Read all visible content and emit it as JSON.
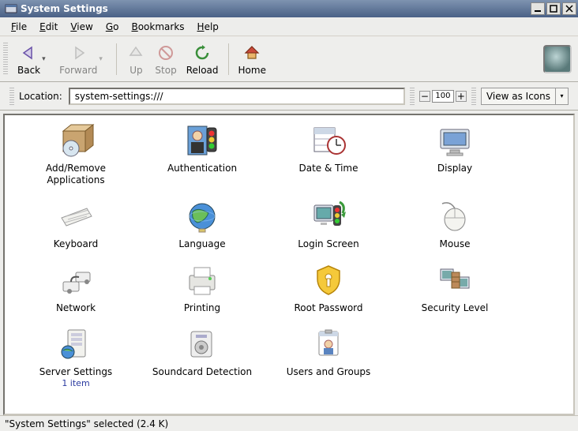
{
  "window": {
    "title": "System Settings"
  },
  "menu": {
    "file": "File",
    "edit": "Edit",
    "view": "View",
    "go": "Go",
    "bookmarks": "Bookmarks",
    "help": "Help"
  },
  "toolbar": {
    "back": "Back",
    "forward": "Forward",
    "up": "Up",
    "stop": "Stop",
    "reload": "Reload",
    "home": "Home"
  },
  "location": {
    "label": "Location:",
    "value": "system-settings:///"
  },
  "zoom": {
    "value": "100"
  },
  "viewmode": {
    "label": "View as Icons"
  },
  "items": [
    {
      "label": "Add/Remove\nApplications"
    },
    {
      "label": "Authentication"
    },
    {
      "label": "Date & Time"
    },
    {
      "label": "Display"
    },
    {
      "label": "Keyboard"
    },
    {
      "label": "Language"
    },
    {
      "label": "Login Screen"
    },
    {
      "label": "Mouse"
    },
    {
      "label": "Network"
    },
    {
      "label": "Printing"
    },
    {
      "label": "Root Password"
    },
    {
      "label": "Security Level"
    },
    {
      "label": "Server Settings",
      "sub": "1 item"
    },
    {
      "label": "Soundcard Detection"
    },
    {
      "label": "Users and Groups"
    }
  ],
  "status": {
    "text": "\"System Settings\" selected (2.4 K)"
  }
}
